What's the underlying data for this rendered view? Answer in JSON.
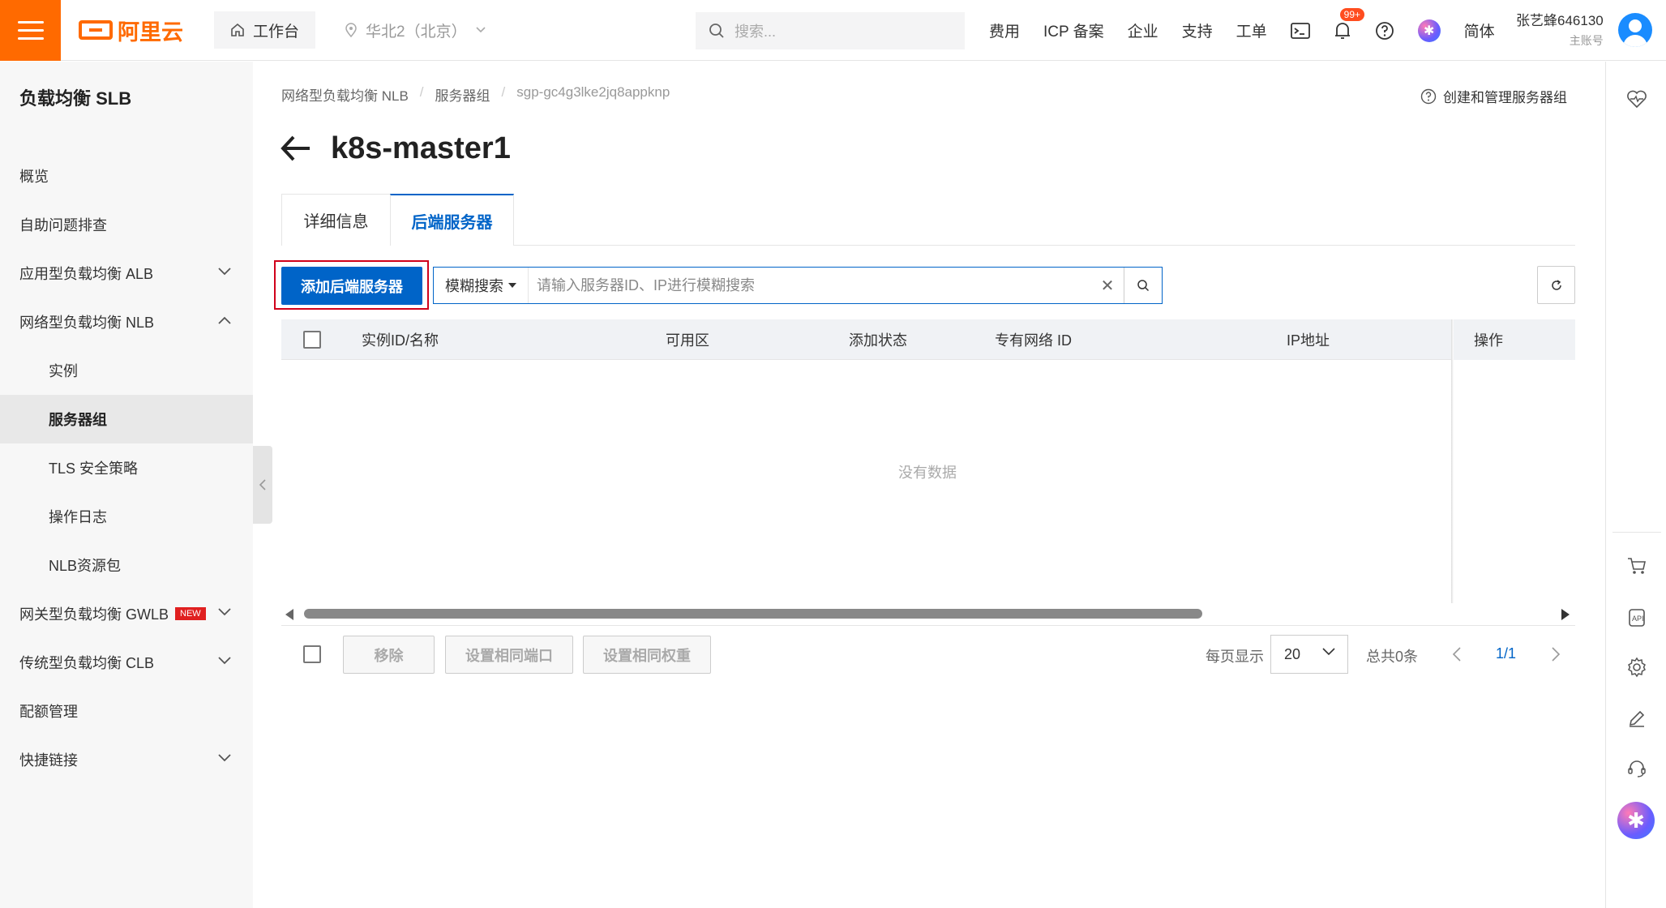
{
  "topbar": {
    "logo_text": "阿里云",
    "workbench_label": "工作台",
    "region_label": "华北2（北京）",
    "search_placeholder": "搜索...",
    "links": [
      "费用",
      "ICP 备案",
      "企业",
      "支持",
      "工单"
    ],
    "notification_badge": "99+",
    "language": "简体",
    "user_name": "张艺蜂646130",
    "account_type": "主账号"
  },
  "sidebar": {
    "title": "负载均衡 SLB",
    "items": [
      {
        "label": "概览"
      },
      {
        "label": "自助问题排查"
      },
      {
        "label": "应用型负载均衡 ALB"
      },
      {
        "label": "网络型负载均衡 NLB"
      },
      {
        "label": "实例"
      },
      {
        "label": "服务器组"
      },
      {
        "label": "TLS 安全策略"
      },
      {
        "label": "操作日志"
      },
      {
        "label": "NLB资源包"
      },
      {
        "label": "网关型负载均衡 GWLB",
        "badge": "NEW"
      },
      {
        "label": "传统型负载均衡 CLB"
      },
      {
        "label": "配额管理"
      },
      {
        "label": "快捷链接"
      }
    ]
  },
  "breadcrumb": [
    "网络型负载均衡 NLB",
    "服务器组",
    "sgp-gc4g3lke2jq8appknp"
  ],
  "help_link": "创建和管理服务器组",
  "page_title": "k8s-master1",
  "tabs": [
    "详细信息",
    "后端服务器"
  ],
  "toolbar": {
    "add_button": "添加后端服务器",
    "filter_type": "模糊搜索",
    "search_placeholder": "请输入服务器ID、IP进行模糊搜索"
  },
  "table": {
    "columns": [
      "实例ID/名称",
      "可用区",
      "添加状态",
      "专有网络 ID",
      "IP地址",
      "操作"
    ],
    "empty_text": "没有数据"
  },
  "footer": {
    "remove_button": "移除",
    "set_port_button": "设置相同端口",
    "set_weight_button": "设置相同权重",
    "page_size_label": "每页显示",
    "page_size": "20",
    "total": "总共0条",
    "page": "1/1"
  },
  "colors": {
    "brand_orange": "#ff6a00",
    "primary_blue": "#0064c8",
    "highlight_red": "#d0021b"
  }
}
